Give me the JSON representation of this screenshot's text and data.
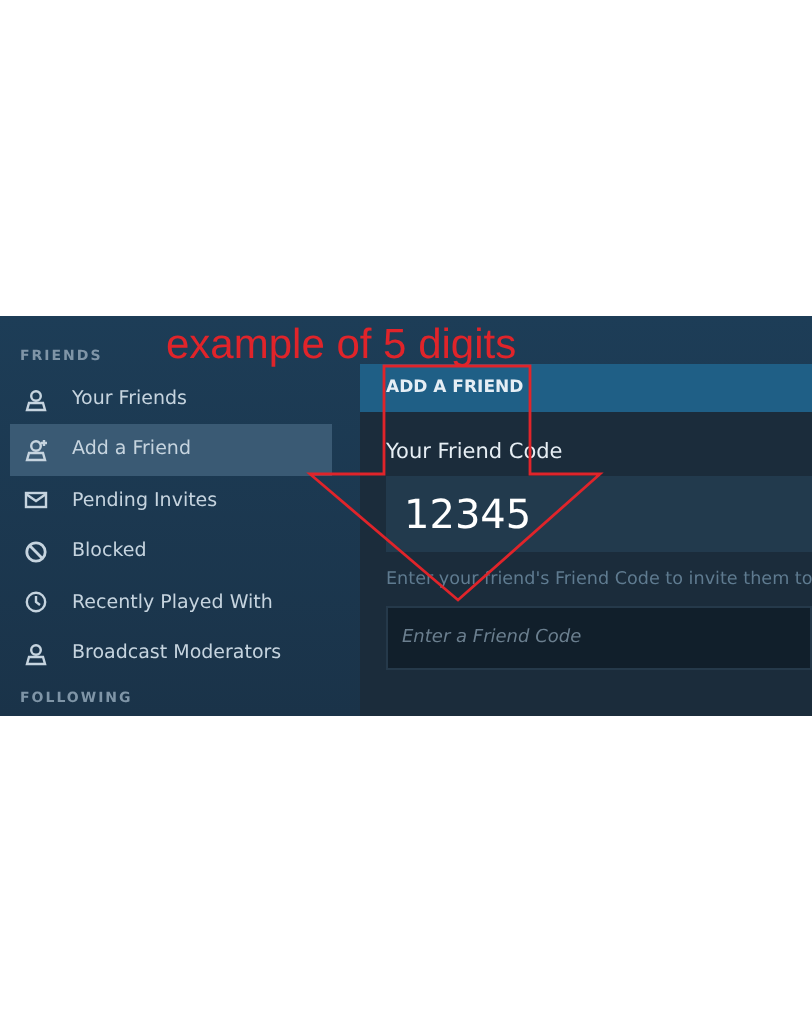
{
  "annotation": {
    "text": "example of 5 digits"
  },
  "sidebar": {
    "sections": [
      {
        "title": "FRIENDS",
        "items": [
          {
            "label": "Your Friends",
            "selected": false
          },
          {
            "label": "Add a Friend",
            "selected": true
          },
          {
            "label": "Pending Invites",
            "selected": false
          },
          {
            "label": "Blocked",
            "selected": false
          },
          {
            "label": "Recently Played With",
            "selected": false
          },
          {
            "label": "Broadcast Moderators",
            "selected": false
          }
        ]
      },
      {
        "title": "FOLLOWING"
      }
    ]
  },
  "panel": {
    "title": "ADD A FRIEND",
    "code_label": "Your Friend Code",
    "code": "12345",
    "hint": "Enter your friend's Friend Code to invite them to",
    "input": {
      "placeholder": "Enter a Friend Code"
    }
  }
}
